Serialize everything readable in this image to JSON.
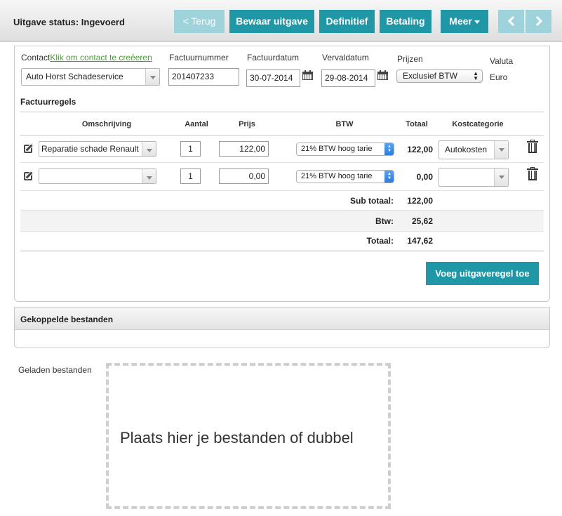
{
  "toolbar": {
    "status": "Uitgave status: Ingevoerd",
    "back_label": "< Terug",
    "save_label": "Bewaar uitgave",
    "final_label": "Definitief",
    "payment_label": "Betaling",
    "more_label": "Meer"
  },
  "form": {
    "contact_label": "Contact",
    "contact_link": "Klik om contact te creëeren",
    "contact_value": "Auto Horst Schadeservice",
    "invoice_number_label": "Factuurnummer",
    "invoice_number_value": "201407233",
    "invoice_date_label": "Factuurdatum",
    "invoice_date_value": "30-07-2014",
    "due_date_label": "Vervaldatum",
    "due_date_value": "29-08-2014",
    "prices_label": "Prijzen",
    "prices_value": "Exclusief BTW",
    "currency_label": "Valuta",
    "currency_value": "Euro"
  },
  "lines": {
    "title": "Factuurregels",
    "headers": {
      "description": "Omschrijving",
      "quantity": "Aantal",
      "price": "Prijs",
      "vat": "BTW",
      "total": "Totaal",
      "category": "Kostcategorie"
    },
    "rows": [
      {
        "description": "Reparatie schade Renault",
        "quantity": "1",
        "price": "122,00",
        "vat": "21% BTW hoog tarie",
        "total": "122,00",
        "category": "Autokosten"
      },
      {
        "description": "",
        "quantity": "1",
        "price": "0,00",
        "vat": "21% BTW hoog tarie",
        "total": "0,00",
        "category": ""
      }
    ],
    "subtotal_label": "Sub totaal:",
    "subtotal_value": "122,00",
    "vat_label": "Btw:",
    "vat_value": "25,62",
    "total_label": "Totaal:",
    "total_value": "147,62",
    "add_button": "Voeg uitgaveregel toe"
  },
  "attachments": {
    "title": "Gekoppelde bestanden",
    "loaded_label": "Geladen bestanden",
    "dropzone_text": "Plaats hier je bestanden of dubbel"
  }
}
